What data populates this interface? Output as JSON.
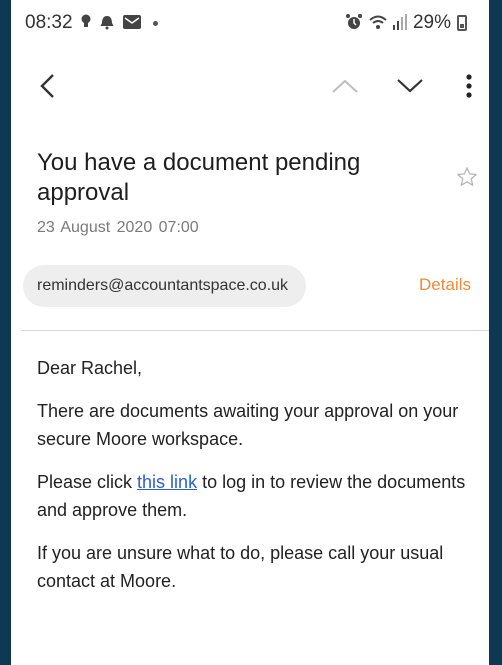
{
  "status_bar": {
    "time": "08:32",
    "battery_percent": "29%",
    "icons": [
      "bulb-icon",
      "alarm-icon",
      "mail-notification-icon",
      "dot-icon",
      "alarm-clock-icon",
      "wifi-icon",
      "signal-icon",
      "battery-icon"
    ]
  },
  "toolbar": {
    "icons": [
      "back-arrow-icon",
      "chevron-up-icon",
      "chevron-down-icon",
      "more-vertical-icon"
    ]
  },
  "email": {
    "subject": "You have a document pending approval",
    "date": "23 August 2020  07:00",
    "sender": "reminders@accountantspace.co.uk",
    "details_label": "Details",
    "greeting": "Dear Rachel,",
    "para1": "There are documents awaiting your approval on your secure Moore workspace.",
    "para2_before": "Please click ",
    "para2_link": "this link",
    "para2_after": " to log in to review the documents and approve them.",
    "para3": "If you are unsure what to do, please call your usual contact at Moore."
  },
  "colors": {
    "frame": "#0d3a52",
    "details_accent": "#f08a3c",
    "link": "#2a5fd6"
  }
}
